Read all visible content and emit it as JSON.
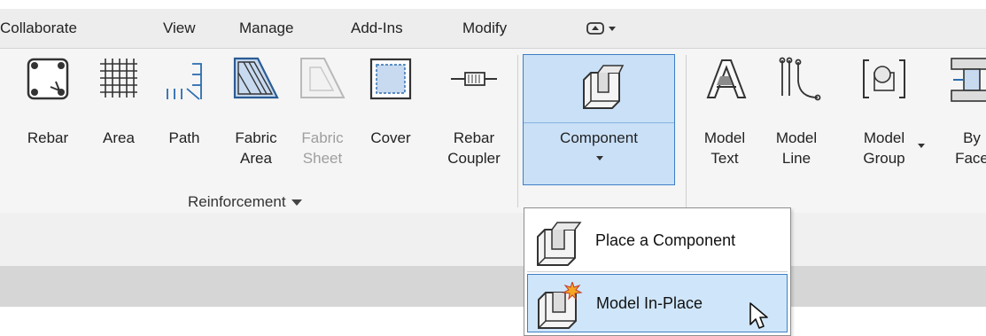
{
  "menu": {
    "items": [
      "Collaborate",
      "View",
      "Manage",
      "Add-Ins",
      "Modify"
    ],
    "quick_access_glyph": "⊡▾"
  },
  "reinforcement_panel": {
    "title": "Reinforcement",
    "tools": [
      {
        "line1": "Rebar",
        "line2": "",
        "icon": "rebar-icon",
        "enabled": true
      },
      {
        "line1": "Area",
        "line2": "",
        "icon": "area-reinforcement-icon",
        "enabled": true
      },
      {
        "line1": "Path",
        "line2": "",
        "icon": "path-reinforcement-icon",
        "enabled": true
      },
      {
        "line1": "Fabric",
        "line2": "Area",
        "icon": "fabric-area-icon",
        "enabled": true
      },
      {
        "line1": "Fabric",
        "line2": "Sheet",
        "icon": "fabric-sheet-icon",
        "enabled": false
      },
      {
        "line1": "Cover",
        "line2": "",
        "icon": "cover-icon",
        "enabled": true
      },
      {
        "line1": "Rebar",
        "line2": "Coupler",
        "icon": "rebar-coupler-icon",
        "enabled": true
      }
    ]
  },
  "model_panel": {
    "component": {
      "label": "Component",
      "icon": "component-icon"
    },
    "tools": [
      {
        "line1": "Model",
        "line2": "Text",
        "icon": "model-text-icon"
      },
      {
        "line1": "Model",
        "line2": "Line",
        "icon": "model-line-icon"
      },
      {
        "line1": "Model",
        "line2": "Group",
        "icon": "model-group-icon"
      },
      {
        "line1": "By",
        "line2": "Face",
        "icon": "by-face-icon"
      }
    ]
  },
  "dropdown": {
    "items": [
      {
        "label": "Place a Component",
        "icon": "place-component-icon",
        "hovered": false
      },
      {
        "label": "Model In-Place",
        "icon": "model-in-place-icon",
        "hovered": true
      }
    ]
  },
  "colors": {
    "active_fill": "#c9e0f7",
    "active_border": "#3d7fc4",
    "ribbon_bg": "#f5f5f5",
    "disabled_text": "#9e9e9e"
  }
}
